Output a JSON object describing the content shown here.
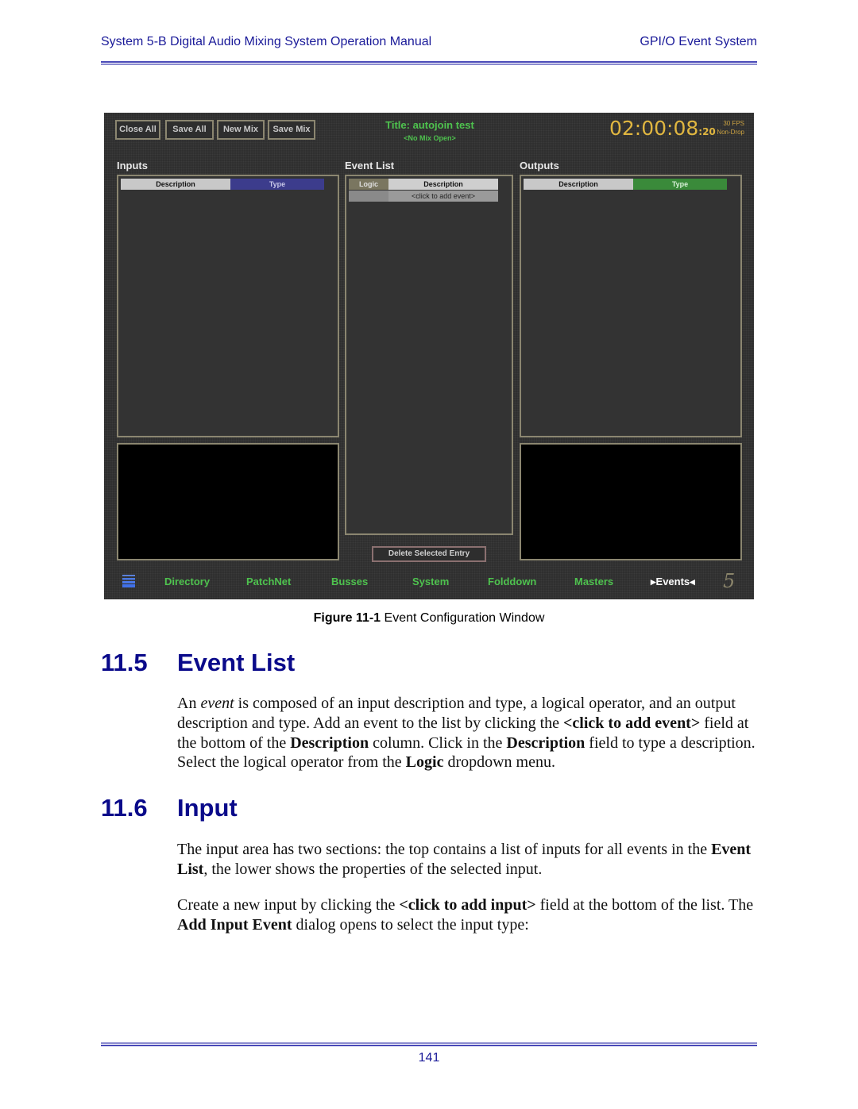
{
  "header": {
    "left": "System 5-B Digital Audio Mixing System Operation Manual",
    "right": "GPI/O Event System"
  },
  "app": {
    "toolbar": [
      "Close All",
      "Save All",
      "New Mix",
      "Save Mix"
    ],
    "title": "Title: autojoin test",
    "mix_status": "<No Mix Open>",
    "timecode": {
      "main": "02:00:08",
      "frames": ":20",
      "rate": "30 FPS",
      "mode": "Non-Drop"
    },
    "inputs": {
      "label": "Inputs",
      "columns": [
        "Description",
        "Type"
      ]
    },
    "event_list": {
      "label": "Event List",
      "columns": [
        "Logic",
        "Description"
      ],
      "add_row": "<click to add event>",
      "delete_button": "Delete Selected Entry"
    },
    "outputs": {
      "label": "Outputs",
      "columns": [
        "Description",
        "Type"
      ]
    },
    "colors": {
      "inputs_type": "#3c3c8c",
      "outputs_type": "#3a8a3a",
      "logic": "#7a7660",
      "accent_green": "#4ec24e",
      "timecode": "#e0b640"
    },
    "nav": [
      {
        "label": "Directory",
        "icon": "menu-stack-icon"
      },
      {
        "label": "PatchNet"
      },
      {
        "label": "Busses"
      },
      {
        "label": "System"
      },
      {
        "label": "Folddown"
      },
      {
        "label": "Masters"
      },
      {
        "label": "Events",
        "active": true
      },
      {
        "label": "",
        "icon": "system5-logo-icon"
      }
    ]
  },
  "figure_caption": {
    "label": "Figure 11-1",
    "text": " Event Configuration Window"
  },
  "sections": [
    {
      "number": "11.5",
      "title": "Event List"
    },
    {
      "number": "11.6",
      "title": "Input"
    }
  ],
  "paragraphs": {
    "p1": [
      "An ",
      "event",
      " is composed of an input description and type, a logical operator, and an output description and type. Add an event to the list by clicking the ",
      "<click to add event>",
      " field at the bottom of the ",
      "Description",
      " column. Click in the ",
      "Description",
      " field to type a description. Select the logical operator from the ",
      "Logic",
      " dropdown menu."
    ],
    "p2": [
      "The input area has two sections: the top contains a list of inputs for all events in the ",
      "Event List",
      ", the lower shows the properties of the selected input."
    ],
    "p3": [
      "Create a new input by clicking the ",
      "<click to add input>",
      " field at the bottom of the list. The ",
      "Add Input Event",
      " dialog opens to select the input type:"
    ]
  },
  "page_number": "141"
}
